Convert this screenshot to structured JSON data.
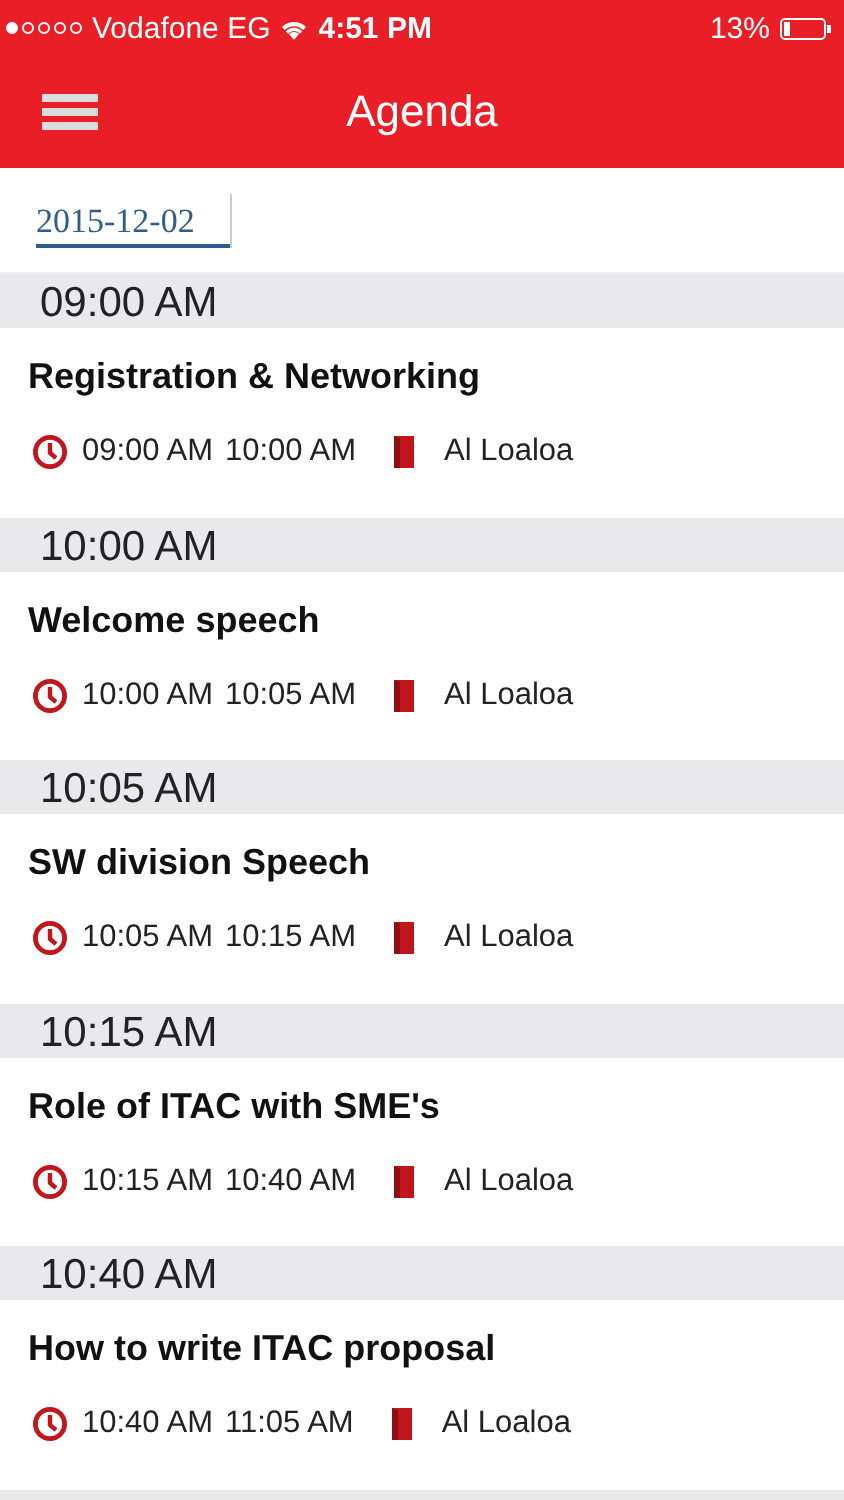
{
  "status_bar": {
    "carrier": "Vodafone EG",
    "time": "4:51 PM",
    "battery": "13%"
  },
  "nav": {
    "title": "Agenda"
  },
  "date_tabs": [
    {
      "label": "2015-12-02",
      "selected": true
    }
  ],
  "sections": [
    {
      "time": "09:00 AM",
      "items": [
        {
          "title": "Registration & Networking",
          "start": "09:00 AM",
          "end": "10:00 AM",
          "room": "Al Loaloa"
        }
      ]
    },
    {
      "time": "10:00 AM",
      "items": [
        {
          "title": "Welcome speech",
          "start": "10:00 AM",
          "end": "10:05 AM",
          "room": "Al Loaloa"
        }
      ]
    },
    {
      "time": "10:05 AM",
      "items": [
        {
          "title": "SW division Speech",
          "start": "10:05 AM",
          "end": "10:15 AM",
          "room": "Al Loaloa"
        }
      ]
    },
    {
      "time": "10:15 AM",
      "items": [
        {
          "title": "Role of ITAC with SME's",
          "start": "10:15 AM",
          "end": "10:40 AM",
          "room": "Al Loaloa"
        }
      ]
    },
    {
      "time": "10:40 AM",
      "items": [
        {
          "title": "How to write ITAC proposal",
          "start": "10:40 AM",
          "end": "11:05 AM",
          "room": "Al Loaloa"
        }
      ]
    }
  ]
}
